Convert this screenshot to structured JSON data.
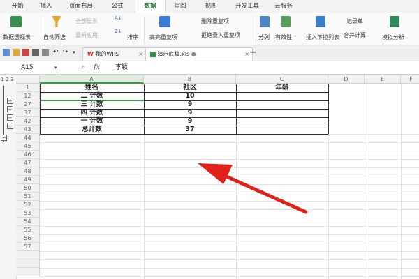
{
  "menu": [
    {
      "label": "开始",
      "active": false
    },
    {
      "label": "插入",
      "active": false
    },
    {
      "label": "页面布局",
      "active": false
    },
    {
      "label": "公式",
      "active": false
    },
    {
      "label": "数据",
      "active": true
    },
    {
      "label": "审阅",
      "active": false
    },
    {
      "label": "视图",
      "active": false
    },
    {
      "label": "开发工具",
      "active": false
    },
    {
      "label": "云服务",
      "active": false
    }
  ],
  "ribbon": {
    "pivot": "数据透视表",
    "autofilter": "自动筛选",
    "show_all": "全部显示",
    "reapply": "重新应用",
    "sort": "排序",
    "highlight_dup": "高亮重复项",
    "remove_dup": "删除重复项",
    "reject_dup": "拒绝录入重复项",
    "split": "分列",
    "validity": "有效性",
    "dropdown": "插入下拉列表",
    "record": "记录单",
    "merge_calc": "合并计算",
    "simulate": "模拟分析"
  },
  "tabs": {
    "mywps": "我的WPS",
    "doc": "演示底稿.xls"
  },
  "formula": {
    "cell_ref": "A15",
    "fx": "fx",
    "content": "李颖"
  },
  "columns": [
    "A",
    "B",
    "C",
    "D",
    "E",
    "F"
  ],
  "rows": [
    {
      "num": "1",
      "a": "姓名",
      "b": "社区",
      "c": "年龄"
    },
    {
      "num": "12",
      "a": "二 计数",
      "b": "10",
      "c": ""
    },
    {
      "num": "27",
      "a": "三 计数",
      "b": "9",
      "c": ""
    },
    {
      "num": "37",
      "a": "四 计数",
      "b": "9",
      "c": ""
    },
    {
      "num": "42",
      "a": "一 计数",
      "b": "9",
      "c": ""
    },
    {
      "num": "43",
      "a": "总计数",
      "b": "37",
      "c": ""
    },
    {
      "num": "44"
    },
    {
      "num": "45"
    },
    {
      "num": "46"
    },
    {
      "num": "47"
    },
    {
      "num": "48"
    },
    {
      "num": "49"
    },
    {
      "num": "50"
    },
    {
      "num": "51"
    },
    {
      "num": "52"
    },
    {
      "num": "53"
    },
    {
      "num": "54"
    },
    {
      "num": "55"
    },
    {
      "num": "56"
    },
    {
      "num": "57"
    }
  ],
  "outline": {
    "levels": [
      "1",
      "2",
      "3"
    ]
  },
  "colors": {
    "accent": "#2a7a3a",
    "arrow": "#e0201b"
  }
}
